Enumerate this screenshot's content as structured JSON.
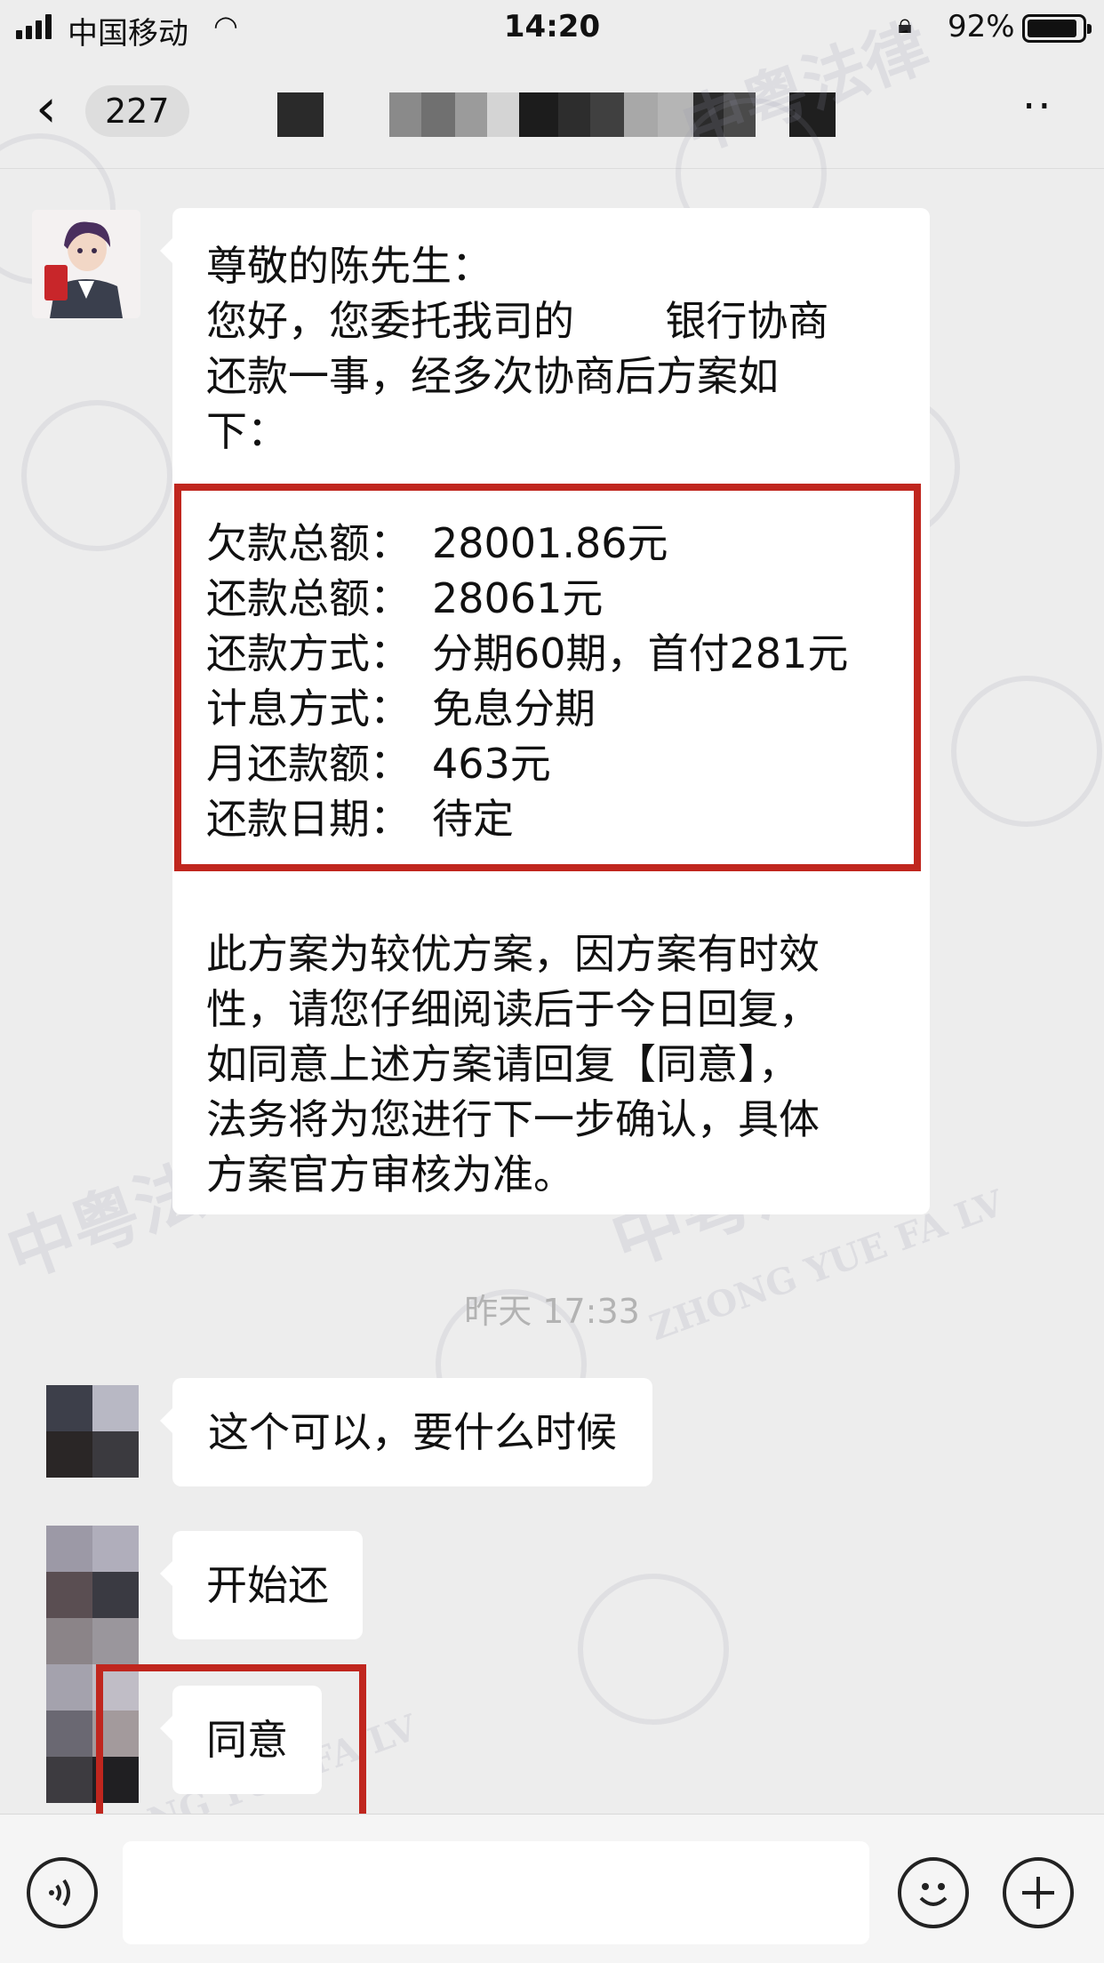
{
  "status_bar": {
    "carrier": "中国移动",
    "time": "14:20",
    "battery_percent": "92%",
    "battery_level": 0.92,
    "icons": [
      "signal-icon",
      "wifi-icon",
      "rotation-lock-icon",
      "battery-icon"
    ]
  },
  "nav": {
    "back_icon": "chevron-left-icon",
    "unread_count": "227",
    "more_icon": "more-icon"
  },
  "messages": {
    "incoming": {
      "greeting_lines": [
        "尊敬的陈先生：",
        "您好，您委托我司的       银行协商",
        "还款一事，经多次协商后方案如",
        "下："
      ],
      "plan": [
        {
          "key": "欠款总额：",
          "value": "28001.86元"
        },
        {
          "key": "还款总额：",
          "value": "28061元"
        },
        {
          "key": "还款方式：",
          "value": "分期60期，首付281元"
        },
        {
          "key": "计息方式：",
          "value": "免息分期"
        },
        {
          "key": "月还款额：",
          "value": "463元"
        },
        {
          "key": "还款日期：",
          "value": "待定"
        }
      ],
      "closing_lines": [
        "此方案为较优方案，因方案有时效",
        "性，请您仔细阅读后于今日回复，",
        "如同意上述方案请回复【同意】，",
        "法务将为您进行下一步确认，具体",
        "方案官方审核为准。"
      ]
    },
    "timestamp": "昨天 17:33",
    "replies": [
      "这个可以，要什么时候",
      "开始还",
      "同意"
    ]
  },
  "input_bar": {
    "voice_icon": "voice-icon",
    "emoji_icon": "emoji-icon",
    "plus_icon": "plus-icon"
  },
  "watermark": {
    "cn": "中粤法律",
    "en": "ZHONG YUE FA LV",
    "seal": "中"
  },
  "colors": {
    "highlight_red": "#c0261e",
    "chat_background": "#ededed",
    "bubble": "#ffffff"
  }
}
